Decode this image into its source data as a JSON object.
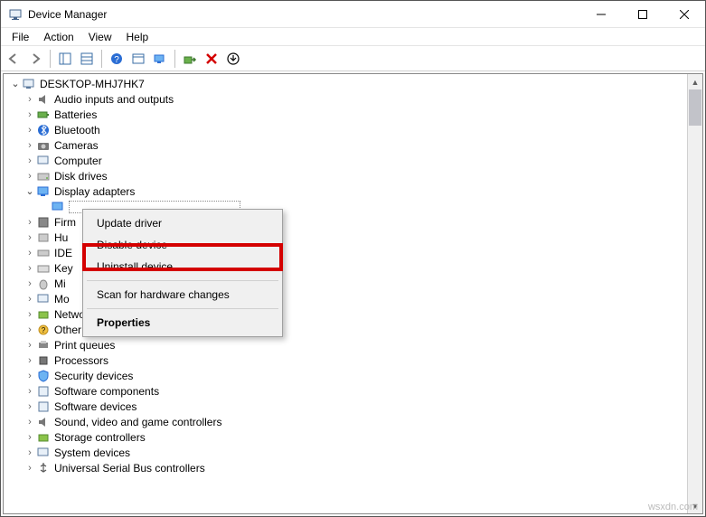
{
  "window": {
    "title": "Device Manager"
  },
  "menubar": [
    "File",
    "Action",
    "View",
    "Help"
  ],
  "tree": {
    "root": "DESKTOP-MHJ7HK7",
    "items": [
      "Audio inputs and outputs",
      "Batteries",
      "Bluetooth",
      "Cameras",
      "Computer",
      "Disk drives",
      "Display adapters",
      "Firm",
      "Hu",
      "IDE",
      "Key",
      "Mi",
      "Mo",
      "Network adapters",
      "Other devices",
      "Print queues",
      "Processors",
      "Security devices",
      "Software components",
      "Software devices",
      "Sound, video and game controllers",
      "Storage controllers",
      "System devices",
      "Universal Serial Bus controllers"
    ]
  },
  "context_menu": {
    "update": "Update driver",
    "disable": "Disable device",
    "uninstall": "Uninstall device",
    "scan": "Scan for hardware changes",
    "properties": "Properties"
  },
  "watermark": "wsxdn.com"
}
